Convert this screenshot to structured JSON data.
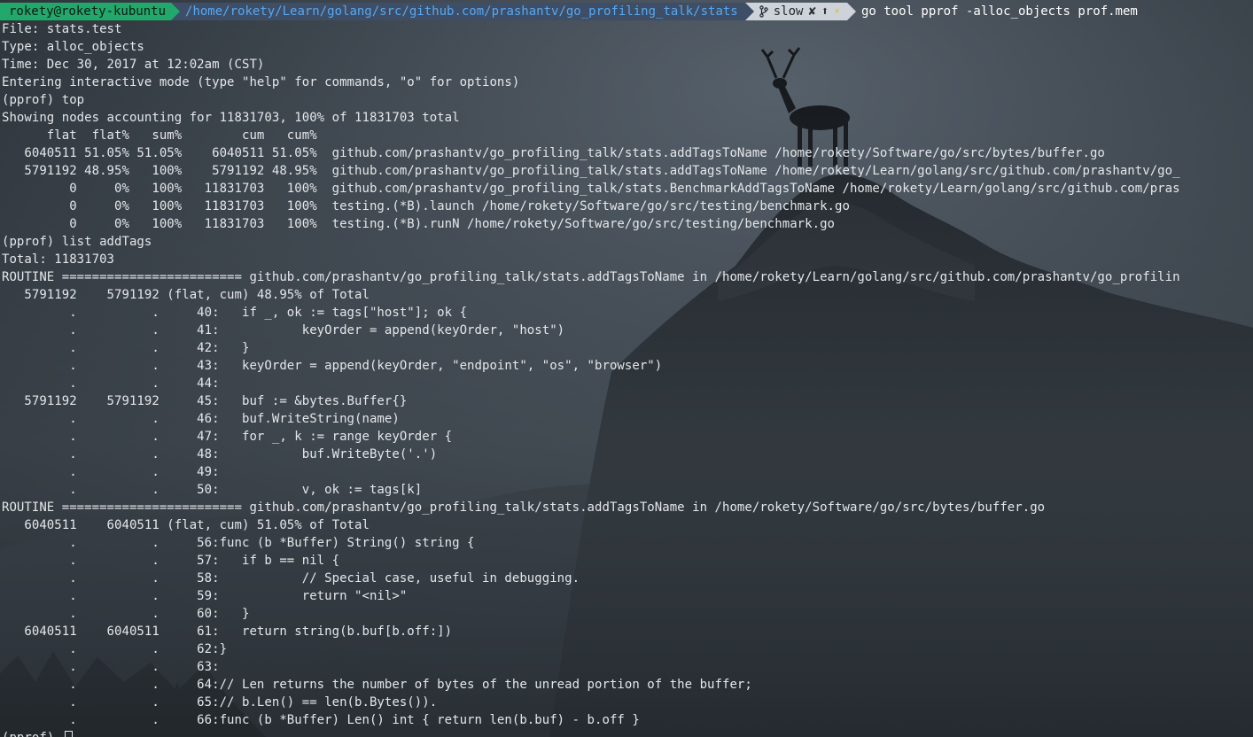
{
  "prompt": {
    "user": "rokety@rokety-kubuntu",
    "path": "/home/rokety/Learn/golang/src/github.com/prashantv/go_profiling_talk/stats",
    "git_icon": "git-branch-icon",
    "branch": "slow",
    "status_dirty": "✘",
    "status_ahead": "⬆",
    "status_stash": "⚡",
    "command": "go tool pprof -alloc_objects prof.mem"
  },
  "colors": {
    "user_segment": "#22a86a",
    "path_segment": "#3d4e66",
    "path_text": "#58a8f0",
    "git_segment": "#cdd3d8",
    "text": "#e4e7ea"
  },
  "lines": [
    "File: stats.test",
    "Type: alloc_objects",
    "Time: Dec 30, 2017 at 12:02am (CST)",
    "Entering interactive mode (type \"help\" for commands, \"o\" for options)",
    "(pprof) top",
    "Showing nodes accounting for 11831703, 100% of 11831703 total",
    "      flat  flat%   sum%        cum   cum%",
    "   6040511 51.05% 51.05%    6040511 51.05%  github.com/prashantv/go_profiling_talk/stats.addTagsToName /home/rokety/Software/go/src/bytes/buffer.go",
    "   5791192 48.95%   100%    5791192 48.95%  github.com/prashantv/go_profiling_talk/stats.addTagsToName /home/rokety/Learn/golang/src/github.com/prashantv/go_",
    "         0     0%   100%   11831703   100%  github.com/prashantv/go_profiling_talk/stats.BenchmarkAddTagsToName /home/rokety/Learn/golang/src/github.com/pras",
    "         0     0%   100%   11831703   100%  testing.(*B).launch /home/rokety/Software/go/src/testing/benchmark.go",
    "         0     0%   100%   11831703   100%  testing.(*B).runN /home/rokety/Software/go/src/testing/benchmark.go",
    "(pprof) list addTags",
    "Total: 11831703",
    "ROUTINE ======================== github.com/prashantv/go_profiling_talk/stats.addTagsToName in /home/rokety/Learn/golang/src/github.com/prashantv/go_profilin",
    "   5791192    5791192 (flat, cum) 48.95% of Total",
    "         .          .     40:   if _, ok := tags[\"host\"]; ok {",
    "         .          .     41:           keyOrder = append(keyOrder, \"host\")",
    "         .          .     42:   }",
    "         .          .     43:   keyOrder = append(keyOrder, \"endpoint\", \"os\", \"browser\")",
    "         .          .     44:",
    "   5791192    5791192     45:   buf := &bytes.Buffer{}",
    "         .          .     46:   buf.WriteString(name)",
    "         .          .     47:   for _, k := range keyOrder {",
    "         .          .     48:           buf.WriteByte('.')",
    "         .          .     49:",
    "         .          .     50:           v, ok := tags[k]",
    "ROUTINE ======================== github.com/prashantv/go_profiling_talk/stats.addTagsToName in /home/rokety/Software/go/src/bytes/buffer.go",
    "   6040511    6040511 (flat, cum) 51.05% of Total",
    "         .          .     56:func (b *Buffer) String() string {",
    "         .          .     57:   if b == nil {",
    "         .          .     58:           // Special case, useful in debugging.",
    "         .          .     59:           return \"<nil>\"",
    "         .          .     60:   }",
    "   6040511    6040511     61:   return string(b.buf[b.off:])",
    "         .          .     62:}",
    "         .          .     63:",
    "         .          .     64:// Len returns the number of bytes of the unread portion of the buffer;",
    "         .          .     65:// b.Len() == len(b.Bytes()).",
    "         .          .     66:func (b *Buffer) Len() int { return len(b.buf) - b.off }",
    "(pprof) "
  ]
}
